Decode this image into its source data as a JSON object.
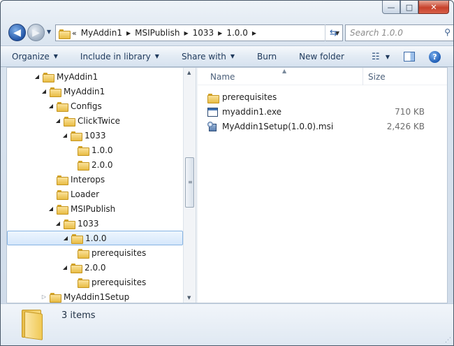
{
  "window": {
    "caption_buttons": {
      "minimize": "—",
      "maximize": "□",
      "close": "✕"
    }
  },
  "address_bar": {
    "chevron": "«",
    "crumbs": [
      "MyAddin1",
      "MSIPublish",
      "1033",
      "1.0.0"
    ],
    "crumb_sep": "▶",
    "search_placeholder": "Search 1.0.0"
  },
  "toolbar": {
    "organize": "Organize",
    "include_in_library": "Include in library",
    "share_with": "Share with",
    "burn": "Burn",
    "new_folder": "New folder"
  },
  "tree": [
    {
      "label": "MyAddin1",
      "depth": 0,
      "arrow": "expanded"
    },
    {
      "label": "MyAddin1",
      "depth": 1,
      "arrow": "expanded"
    },
    {
      "label": "Configs",
      "depth": 2,
      "arrow": "expanded"
    },
    {
      "label": "ClickTwice",
      "depth": 3,
      "arrow": "expanded"
    },
    {
      "label": "1033",
      "depth": 4,
      "arrow": "expanded"
    },
    {
      "label": "1.0.0",
      "depth": 5,
      "arrow": "none"
    },
    {
      "label": "2.0.0",
      "depth": 5,
      "arrow": "none"
    },
    {
      "label": "Interops",
      "depth": 2,
      "arrow": "none"
    },
    {
      "label": "Loader",
      "depth": 2,
      "arrow": "none"
    },
    {
      "label": "MSIPublish",
      "depth": 2,
      "arrow": "expanded"
    },
    {
      "label": "1033",
      "depth": 3,
      "arrow": "expanded"
    },
    {
      "label": "1.0.0",
      "depth": 4,
      "arrow": "expanded",
      "selected": true
    },
    {
      "label": "prerequisites",
      "depth": 5,
      "arrow": "none"
    },
    {
      "label": "2.0.0",
      "depth": 4,
      "arrow": "expanded"
    },
    {
      "label": "prerequisites",
      "depth": 5,
      "arrow": "none"
    },
    {
      "label": "MyAddin1Setup",
      "depth": 1,
      "arrow": "collapsed"
    }
  ],
  "columns": {
    "name": "Name",
    "size": "Size"
  },
  "files": [
    {
      "name": "prerequisites",
      "size": "",
      "icon": "folder-icon"
    },
    {
      "name": "myaddin1.exe",
      "size": "710 KB",
      "icon": "exe-icon"
    },
    {
      "name": "MyAddin1Setup(1.0.0).msi",
      "size": "2,426 KB",
      "icon": "msi-icon"
    }
  ],
  "details": {
    "count": "3 items"
  }
}
